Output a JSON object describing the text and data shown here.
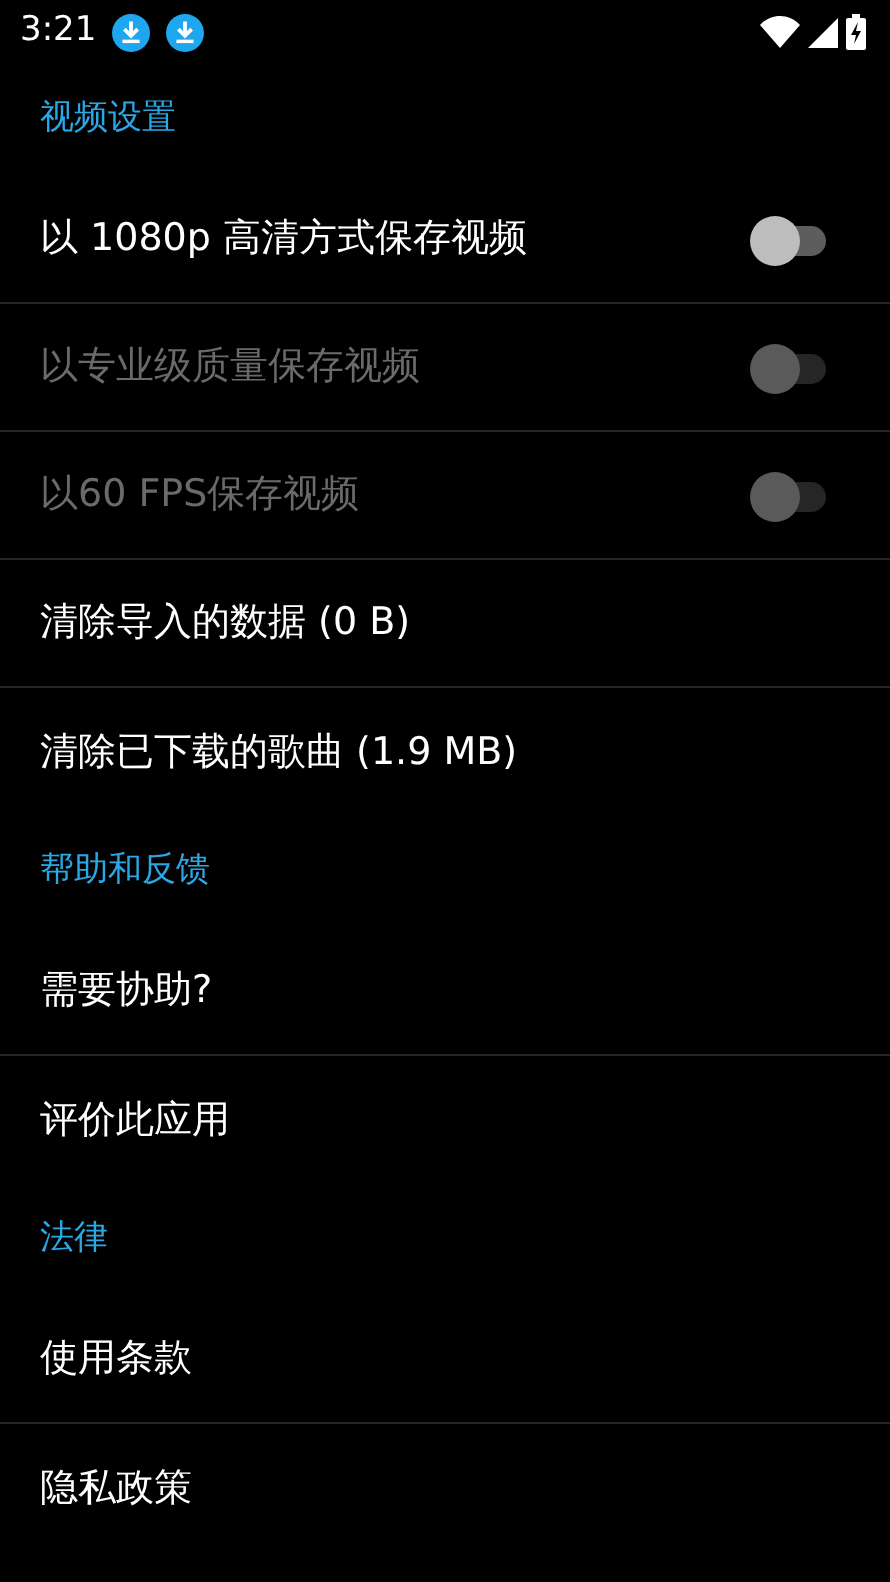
{
  "status_bar": {
    "time": "3:21",
    "notifications": [
      {
        "kind": "download"
      },
      {
        "kind": "download"
      }
    ]
  },
  "sections": [
    {
      "title": "视频设置",
      "items": [
        {
          "kind": "toggle",
          "label": "以 1080p 高清方式保存视频",
          "on": false,
          "disabled": false
        },
        {
          "kind": "toggle",
          "label": "以专业级质量保存视频",
          "on": false,
          "disabled": true
        },
        {
          "kind": "toggle",
          "label": "以60 FPS保存视频",
          "on": false,
          "disabled": true
        },
        {
          "kind": "action",
          "label": "清除导入的数据 (0 B)",
          "disabled": false
        },
        {
          "kind": "action",
          "label": "清除已下载的歌曲 (1.9 MB)",
          "disabled": false
        }
      ]
    },
    {
      "title": "帮助和反馈",
      "items": [
        {
          "kind": "action",
          "label": "需要协助?",
          "disabled": false
        },
        {
          "kind": "action",
          "label": "评价此应用",
          "disabled": false
        }
      ]
    },
    {
      "title": "法律",
      "items": [
        {
          "kind": "action",
          "label": "使用条款",
          "disabled": false
        },
        {
          "kind": "action",
          "label": "隐私政策",
          "disabled": false
        }
      ]
    }
  ]
}
